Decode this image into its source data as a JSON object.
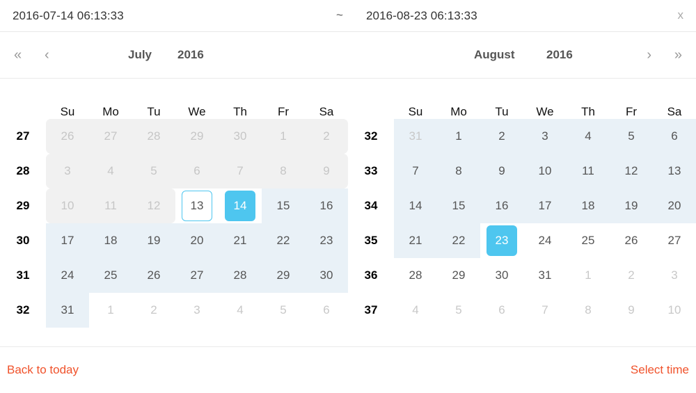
{
  "header": {
    "start_value": "2016-07-14 06:13:33",
    "separator": "~",
    "end_value": "2016-08-23 06:13:33",
    "close_label": "x"
  },
  "nav": {
    "prev_year": "«",
    "prev_month": "‹",
    "next_month": "›",
    "next_year": "»"
  },
  "left_panel": {
    "month": "July",
    "year": "2016",
    "weekdays": [
      "Su",
      "Mo",
      "Tu",
      "We",
      "Th",
      "Fr",
      "Sa"
    ],
    "weeks": [
      {
        "week": "27",
        "days": [
          {
            "label": "26",
            "state": "disabled-other"
          },
          {
            "label": "27",
            "state": "disabled-other"
          },
          {
            "label": "28",
            "state": "disabled-other"
          },
          {
            "label": "29",
            "state": "disabled-other"
          },
          {
            "label": "30",
            "state": "disabled-other"
          },
          {
            "label": "1",
            "state": "disabled"
          },
          {
            "label": "2",
            "state": "disabled"
          }
        ]
      },
      {
        "week": "28",
        "days": [
          {
            "label": "3",
            "state": "disabled"
          },
          {
            "label": "4",
            "state": "disabled"
          },
          {
            "label": "5",
            "state": "disabled"
          },
          {
            "label": "6",
            "state": "disabled"
          },
          {
            "label": "7",
            "state": "disabled"
          },
          {
            "label": "8",
            "state": "disabled"
          },
          {
            "label": "9",
            "state": "disabled"
          }
        ]
      },
      {
        "week": "29",
        "days": [
          {
            "label": "10",
            "state": "disabled"
          },
          {
            "label": "11",
            "state": "disabled"
          },
          {
            "label": "12",
            "state": "disabled"
          },
          {
            "label": "13",
            "state": "today"
          },
          {
            "label": "14",
            "state": "selected-start"
          },
          {
            "label": "15",
            "state": "in-range"
          },
          {
            "label": "16",
            "state": "in-range"
          }
        ]
      },
      {
        "week": "30",
        "days": [
          {
            "label": "17",
            "state": "in-range"
          },
          {
            "label": "18",
            "state": "in-range"
          },
          {
            "label": "19",
            "state": "in-range"
          },
          {
            "label": "20",
            "state": "in-range"
          },
          {
            "label": "21",
            "state": "in-range"
          },
          {
            "label": "22",
            "state": "in-range"
          },
          {
            "label": "23",
            "state": "in-range"
          }
        ]
      },
      {
        "week": "31",
        "days": [
          {
            "label": "24",
            "state": "in-range"
          },
          {
            "label": "25",
            "state": "in-range"
          },
          {
            "label": "26",
            "state": "in-range"
          },
          {
            "label": "27",
            "state": "in-range"
          },
          {
            "label": "28",
            "state": "in-range"
          },
          {
            "label": "29",
            "state": "in-range"
          },
          {
            "label": "30",
            "state": "in-range"
          }
        ]
      },
      {
        "week": "32",
        "days": [
          {
            "label": "31",
            "state": "in-range"
          },
          {
            "label": "1",
            "state": "other-month"
          },
          {
            "label": "2",
            "state": "other-month"
          },
          {
            "label": "3",
            "state": "other-month"
          },
          {
            "label": "4",
            "state": "other-month"
          },
          {
            "label": "5",
            "state": "other-month"
          },
          {
            "label": "6",
            "state": "other-month"
          }
        ]
      }
    ]
  },
  "right_panel": {
    "month": "August",
    "year": "2016",
    "weekdays": [
      "Su",
      "Mo",
      "Tu",
      "We",
      "Th",
      "Fr",
      "Sa"
    ],
    "weeks": [
      {
        "week": "32",
        "days": [
          {
            "label": "31",
            "state": "in-range-other"
          },
          {
            "label": "1",
            "state": "in-range"
          },
          {
            "label": "2",
            "state": "in-range"
          },
          {
            "label": "3",
            "state": "in-range"
          },
          {
            "label": "4",
            "state": "in-range"
          },
          {
            "label": "5",
            "state": "in-range"
          },
          {
            "label": "6",
            "state": "in-range"
          }
        ]
      },
      {
        "week": "33",
        "days": [
          {
            "label": "7",
            "state": "in-range"
          },
          {
            "label": "8",
            "state": "in-range"
          },
          {
            "label": "9",
            "state": "in-range"
          },
          {
            "label": "10",
            "state": "in-range"
          },
          {
            "label": "11",
            "state": "in-range"
          },
          {
            "label": "12",
            "state": "in-range"
          },
          {
            "label": "13",
            "state": "in-range"
          }
        ]
      },
      {
        "week": "34",
        "days": [
          {
            "label": "14",
            "state": "in-range"
          },
          {
            "label": "15",
            "state": "in-range"
          },
          {
            "label": "16",
            "state": "in-range"
          },
          {
            "label": "17",
            "state": "in-range"
          },
          {
            "label": "18",
            "state": "in-range"
          },
          {
            "label": "19",
            "state": "in-range"
          },
          {
            "label": "20",
            "state": "in-range"
          }
        ]
      },
      {
        "week": "35",
        "days": [
          {
            "label": "21",
            "state": "in-range"
          },
          {
            "label": "22",
            "state": "in-range"
          },
          {
            "label": "23",
            "state": "selected-end"
          },
          {
            "label": "24",
            "state": "normal"
          },
          {
            "label": "25",
            "state": "normal"
          },
          {
            "label": "26",
            "state": "normal"
          },
          {
            "label": "27",
            "state": "normal"
          }
        ]
      },
      {
        "week": "36",
        "days": [
          {
            "label": "28",
            "state": "normal"
          },
          {
            "label": "29",
            "state": "normal"
          },
          {
            "label": "30",
            "state": "normal"
          },
          {
            "label": "31",
            "state": "normal"
          },
          {
            "label": "1",
            "state": "other-month"
          },
          {
            "label": "2",
            "state": "other-month"
          },
          {
            "label": "3",
            "state": "other-month"
          }
        ]
      },
      {
        "week": "37",
        "days": [
          {
            "label": "4",
            "state": "other-month"
          },
          {
            "label": "5",
            "state": "other-month"
          },
          {
            "label": "6",
            "state": "other-month"
          },
          {
            "label": "7",
            "state": "other-month"
          },
          {
            "label": "8",
            "state": "other-month"
          },
          {
            "label": "9",
            "state": "other-month"
          },
          {
            "label": "10",
            "state": "other-month"
          }
        ]
      }
    ]
  },
  "footer": {
    "back_to_today": "Back to today",
    "select_time": "Select time"
  },
  "colors": {
    "accent": "#4ec6ef",
    "in_range_bg": "#e9f1f7",
    "disabled_bg": "#f1f1f1",
    "link": "#f0522b",
    "border": "#e9e9e9"
  }
}
